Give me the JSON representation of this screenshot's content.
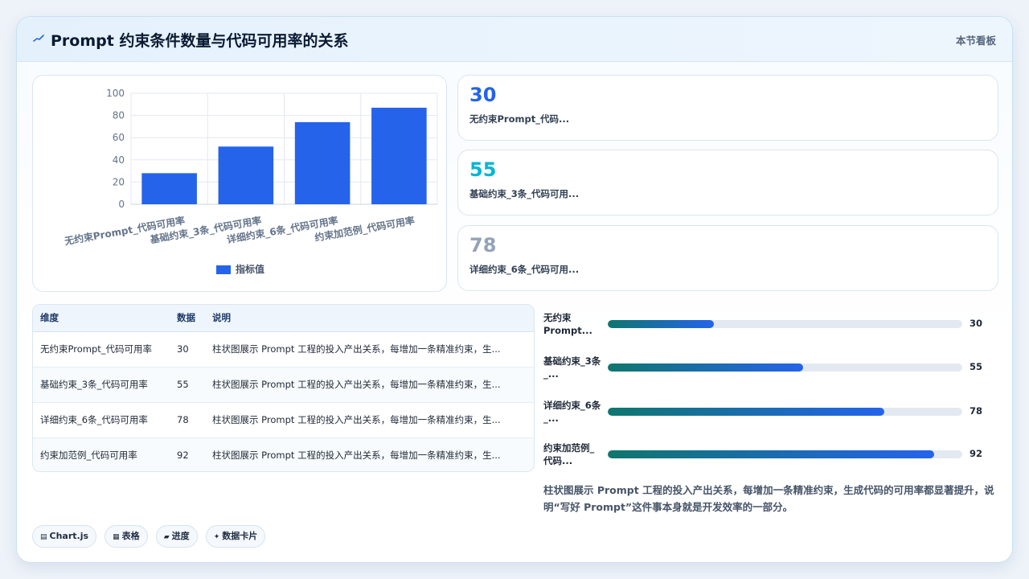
{
  "header": {
    "title": "Prompt 约束条件数量与代码可用率的关系",
    "link": "本节看板"
  },
  "stats": [
    {
      "value": "30",
      "label": "无约束Prompt_代码...",
      "color": "#2563eb"
    },
    {
      "value": "55",
      "label": "基础约束_3条_代码可用...",
      "color": "#06b6d4"
    },
    {
      "value": "78",
      "label": "详细约束_6条_代码可用...",
      "color": "#94a3b8"
    }
  ],
  "table": {
    "headers": [
      "维度",
      "数据",
      "说明"
    ],
    "rows": [
      {
        "dim": "无约束Prompt_代码可用率",
        "val": "30",
        "desc": "柱状图展示 Prompt 工程的投入产出关系，每增加一条精准约束，生..."
      },
      {
        "dim": "基础约束_3条_代码可用率",
        "val": "55",
        "desc": "柱状图展示 Prompt 工程的投入产出关系，每增加一条精准约束，生..."
      },
      {
        "dim": "详细约束_6条_代码可用率",
        "val": "78",
        "desc": "柱状图展示 Prompt 工程的投入产出关系，每增加一条精准约束，生..."
      },
      {
        "dim": "约束加范例_代码可用率",
        "val": "92",
        "desc": "柱状图展示 Prompt 工程的投入产出关系，每增加一条精准约束，生..."
      }
    ]
  },
  "progress": [
    {
      "label": "无约束Prompt...",
      "value": "30",
      "pct": 0.3
    },
    {
      "label": "基础约束_3条_...",
      "value": "55",
      "pct": 0.55
    },
    {
      "label": "详细约束_6条_...",
      "value": "78",
      "pct": 0.78
    },
    {
      "label": "约束加范例_代码...",
      "value": "92",
      "pct": 0.92
    }
  ],
  "note": "柱状图展示 Prompt 工程的投入产出关系，每增加一条精准约束，生成代码的可用率都显著提升，说明“写好 Prompt”这件事本身就是开发效率的一部分。",
  "chips": [
    {
      "icon": "▤",
      "label": "Chart.js"
    },
    {
      "icon": "▦",
      "label": "表格"
    },
    {
      "icon": "▰",
      "label": "进度"
    },
    {
      "icon": "✦",
      "label": "数据卡片"
    }
  ],
  "chart_data": {
    "type": "bar",
    "categories": [
      "无约束Prompt_代码可用率",
      "基础约束_3条_代码可用率",
      "详细约束_6条_代码可用率",
      "约束加范例_代码可用率"
    ],
    "series": [
      {
        "name": "指标值",
        "values": [
          28,
          52,
          74,
          87
        ],
        "color": "#2563eb"
      }
    ],
    "ylim": [
      0,
      100
    ],
    "yticks": [
      0,
      20,
      40,
      60,
      80,
      100
    ],
    "grid": true,
    "legend": "bottom"
  }
}
